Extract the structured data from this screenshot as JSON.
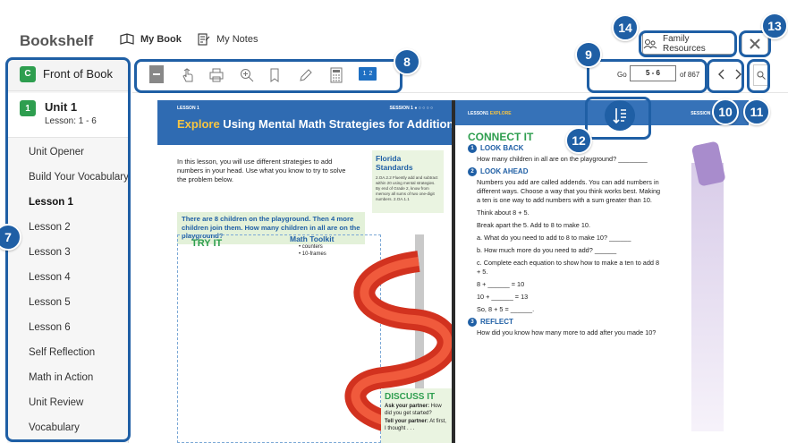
{
  "app": {
    "brand": "Bookshelf",
    "tabs": {
      "my_book": "My Book",
      "my_notes": "My Notes"
    },
    "family_resources": "Family Resources",
    "colors": {
      "accent": "#1f5fa5",
      "green": "#2e9e4f",
      "header_blue": "#2f6bb2"
    }
  },
  "sidebar": {
    "front_of_book": {
      "badge": "C",
      "label": "Front of Book"
    },
    "unit": {
      "badge": "1",
      "title": "Unit 1",
      "subtitle": "Lesson: 1 - 6"
    },
    "items": [
      {
        "label": "Unit Opener"
      },
      {
        "label": "Build Your Vocabulary"
      },
      {
        "label": "Lesson 1"
      },
      {
        "label": "Lesson 2"
      },
      {
        "label": "Lesson 3"
      },
      {
        "label": "Lesson 4"
      },
      {
        "label": "Lesson 5"
      },
      {
        "label": "Lesson 6"
      },
      {
        "label": "Self Reflection"
      },
      {
        "label": "Math in Action"
      },
      {
        "label": "Unit Review"
      },
      {
        "label": "Vocabulary"
      }
    ],
    "active_index": 2
  },
  "toolbar": {
    "icons": [
      "minus-icon",
      "hand-pointer-icon",
      "print-icon",
      "zoom-in-icon",
      "bookmark-icon",
      "pencil-icon",
      "calculator-icon",
      "page-layout-icon"
    ],
    "pages_toggle": {
      "a": "1",
      "b": "2"
    },
    "go_label": "Go",
    "page_value": "5 - 6",
    "of_label": "of 867"
  },
  "callouts": {
    "c7": "7",
    "c8": "8",
    "c9": "9",
    "c10": "10",
    "c11": "11",
    "c12": "12",
    "c13": "13",
    "c14": "14"
  },
  "left_page": {
    "lesson_label": "LESSON 1",
    "session_label": "SESSION 1 ● ○ ○ ○ ○",
    "title_explore": "Explore",
    "title_rest": " Using Mental Math Strategies for Addition",
    "intro": "In this lesson, you will use different strategies to add numbers in your head. Use what you know to try to solve the problem below.",
    "standards_heading": "Florida Standards",
    "standards_text": "2.OA.2.2 Fluently add and subtract within 20 using mental strategies. By end of Grade 2, know from memory all sums of two one-digit numbers. 2.OA.1.1",
    "question": "There are 8 children on the playground. Then 4 more children join them. How many children in all are on the playground?",
    "try_it": "TRY IT",
    "toolkit_heading": "Math Toolkit",
    "toolkit_items": [
      "• counters",
      "• 10-frames"
    ],
    "discuss_heading": "DISCUSS IT",
    "discuss_l1_bold": "Ask your partner:",
    "discuss_l1": " How did you get started?",
    "discuss_l2_bold": "Tell your partner:",
    "discuss_l2": " At first, I thought . . ."
  },
  "right_page": {
    "lesson_label": "LESSON1",
    "lesson_explore": "EXPLORE",
    "session_label": "SESSION 1 ●",
    "connect_it": "CONNECT IT",
    "s1_num": "1",
    "s1_heading": "LOOK BACK",
    "s1_text": "How many children in all are on the playground? ________",
    "s2_num": "2",
    "s2_heading": "LOOK AHEAD",
    "s2_text": "Numbers you add are called addends. You can add numbers in different ways. Choose a way that you think works best. Making a ten is one way to add numbers with a sum greater than 10.",
    "think": "Think about 8 + 5.",
    "breakapart": "Break apart the 5. Add to 8 to make 10.",
    "qa": "a. What do you need to add to 8 to make 10? ______",
    "qb": "b. How much more do you need to add? ______",
    "qc": "c. Complete each equation to show how to make a ten to add 8 + 5.",
    "eq1": "8 + ______ = 10",
    "eq2": "10 + ______ = 13",
    "eq3": "So, 8 + 5 = ______.",
    "s3_num": "3",
    "s3_heading": "REFLECT",
    "s3_text": "How did you know how many more to add after you made 10?"
  }
}
